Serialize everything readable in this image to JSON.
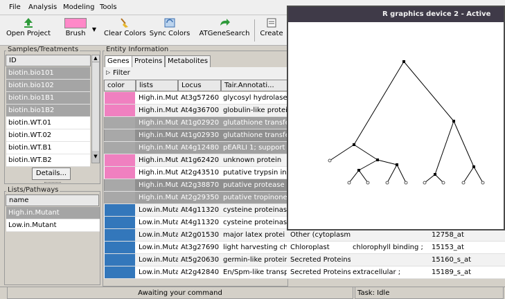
{
  "menubar": {
    "items": [
      "File",
      "Analysis",
      "Modeling",
      "Tools"
    ]
  },
  "toolbar": {
    "open_project": "Open Project",
    "brush": "Brush",
    "clear_colors": "Clear Colors",
    "sync_colors": "Sync Colors",
    "atgenesearch": "ATGeneSearch",
    "create": "Create",
    "brush_color": "#ff88c8"
  },
  "samples": {
    "title": "Samples/Treatments",
    "header": "ID",
    "items": [
      {
        "label": "biotin.bio101",
        "selected": true
      },
      {
        "label": "biotin.bio102",
        "selected": true
      },
      {
        "label": "biotin.bio1B1",
        "selected": true
      },
      {
        "label": "biotin.bio1B2",
        "selected": true
      },
      {
        "label": "biotin.WT.01",
        "selected": false
      },
      {
        "label": "biotin.WT.02",
        "selected": false
      },
      {
        "label": "biotin.WT.B1",
        "selected": false
      },
      {
        "label": "biotin.WT.B2",
        "selected": false
      }
    ],
    "details_button": "Details..."
  },
  "lists": {
    "title": "Lists/Pathways",
    "header": "name",
    "items": [
      {
        "label": "High.in.Mutant",
        "selected": true
      },
      {
        "label": "Low.in.Mutant",
        "selected": false
      }
    ]
  },
  "entity": {
    "title": "Entity Information",
    "tabs": [
      "Genes",
      "Proteins",
      "Metabolites"
    ],
    "filter_label": "Filter",
    "columns": [
      "color",
      "lists",
      "Locus",
      "Tair.Annotati..."
    ],
    "rows": [
      {
        "color": "#f080c0",
        "list": "High.in.Muta",
        "locus": "At3g57260",
        "annot": "glycosyl hydrolase",
        "loc": "",
        "func": "",
        "probe": "",
        "selected": false
      },
      {
        "color": "#f080c0",
        "list": "High.in.Muta",
        "locus": "At4g36700",
        "annot": "globulin-like protei",
        "loc": "",
        "func": "",
        "probe": "",
        "selected": false
      },
      {
        "color": "#a8a8a8",
        "list": "High.in.Muta",
        "locus": "At1g02920",
        "annot": "glutathione transfe",
        "loc": "",
        "func": "",
        "probe": "",
        "selected": true
      },
      {
        "color": "#a8a8a8",
        "list": "High.in.Muta",
        "locus": "At1g02930",
        "annot": "glutathione transfe",
        "loc": "",
        "func": "",
        "probe": "",
        "selected": true
      },
      {
        "color": "#a8a8a8",
        "list": "High.in.Muta",
        "locus": "At4g12480",
        "annot": "pEARLI 1; support",
        "loc": "",
        "func": "",
        "probe": "",
        "selected": true
      },
      {
        "color": "#f080c0",
        "list": "High.in.Muta",
        "locus": "At1g62420",
        "annot": "unknown protein",
        "loc": "",
        "func": "",
        "probe": "",
        "selected": false
      },
      {
        "color": "#f080c0",
        "list": "High.in.Muta",
        "locus": "At2g43510",
        "annot": "putative trypsin in",
        "loc": "",
        "func": "",
        "probe": "",
        "selected": false
      },
      {
        "color": "#a8a8a8",
        "list": "High.in.Muta",
        "locus": "At2g38870",
        "annot": "putative protease",
        "loc": "",
        "func": "",
        "probe": "",
        "selected": true
      },
      {
        "color": "#a8a8a8",
        "list": "High.in.Muta",
        "locus": "At2g29350",
        "annot": "putative tropinone",
        "loc": "",
        "func": "",
        "probe": "",
        "selected": true
      },
      {
        "color": "#3377bb",
        "list": "Low.in.Muta",
        "locus": "At4g11320",
        "annot": "cysteine proteinas",
        "loc": "",
        "func": "",
        "probe": "",
        "selected": false
      },
      {
        "color": "#3377bb",
        "list": "Low.in.Muta",
        "locus": "At4g11320",
        "annot": "cysteine proteinas",
        "loc": "",
        "func": "",
        "probe": "",
        "selected": false
      },
      {
        "color": "#3377bb",
        "list": "Low.in.Muta",
        "locus": "At2g01530",
        "annot": "major latex protei",
        "loc": "Other (cytoplasm",
        "func": "",
        "probe": "12758_at",
        "selected": false
      },
      {
        "color": "#3377bb",
        "list": "Low.in.Muta",
        "locus": "At3g27690",
        "annot": "light harvesting ch",
        "loc": "Chloroplast",
        "func": "chlorophyll binding ;",
        "probe": "15153_at",
        "selected": false
      },
      {
        "color": "#3377bb",
        "list": "Low.in.Muta",
        "locus": "At5g20630",
        "annot": "germin-like protein",
        "loc": "Secreted Proteins",
        "func": "",
        "probe": "15160_s_at",
        "selected": false
      },
      {
        "color": "#3377bb",
        "list": "Low.in.Muta",
        "locus": "At2g42840",
        "annot": "En/Spm-like transp",
        "loc": "Secreted Proteins",
        "func": "extracellular ;",
        "probe": "15189_s_at",
        "selected": false
      }
    ]
  },
  "status": {
    "message": "Awaiting your command",
    "task": "Task: Idle"
  },
  "rwindow": {
    "title": "R graphics device 2 - Active"
  }
}
